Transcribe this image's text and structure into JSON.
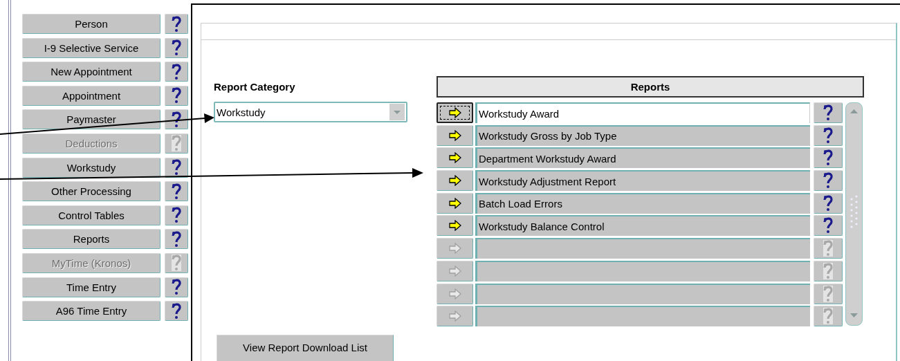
{
  "sidebar": {
    "items": [
      {
        "label": "Person",
        "disabled": false
      },
      {
        "label": "I-9 Selective Service",
        "disabled": false
      },
      {
        "label": "New Appointment",
        "disabled": false
      },
      {
        "label": "Appointment",
        "disabled": false
      },
      {
        "label": "Paymaster",
        "disabled": false
      },
      {
        "label": "Deductions",
        "disabled": true
      },
      {
        "label": "Workstudy",
        "disabled": false
      },
      {
        "label": "Other Processing",
        "disabled": false
      },
      {
        "label": "Control Tables",
        "disabled": false
      },
      {
        "label": "Reports",
        "disabled": false
      },
      {
        "label": "MyTime (Kronos)",
        "disabled": true
      },
      {
        "label": "Time Entry",
        "disabled": false
      },
      {
        "label": "A96 Time Entry",
        "disabled": false
      }
    ]
  },
  "report_category": {
    "label": "Report Category",
    "value": "Workstudy"
  },
  "reports": {
    "title": "Reports",
    "rows": [
      {
        "name": "Workstudy Award",
        "disabled": false,
        "selected": true
      },
      {
        "name": "Workstudy Gross by Job Type",
        "disabled": false,
        "selected": false
      },
      {
        "name": "Department Workstudy Award",
        "disabled": false,
        "selected": false
      },
      {
        "name": "Workstudy Adjustment Report",
        "disabled": false,
        "selected": false
      },
      {
        "name": "Batch Load Errors",
        "disabled": false,
        "selected": false
      },
      {
        "name": "Workstudy Balance Control",
        "disabled": false,
        "selected": false
      },
      {
        "disabled": true,
        "selected": false
      },
      {
        "disabled": true,
        "selected": false
      },
      {
        "disabled": true,
        "selected": false
      },
      {
        "disabled": true,
        "selected": false
      }
    ]
  },
  "download_button": {
    "label": "View Report Download List"
  }
}
